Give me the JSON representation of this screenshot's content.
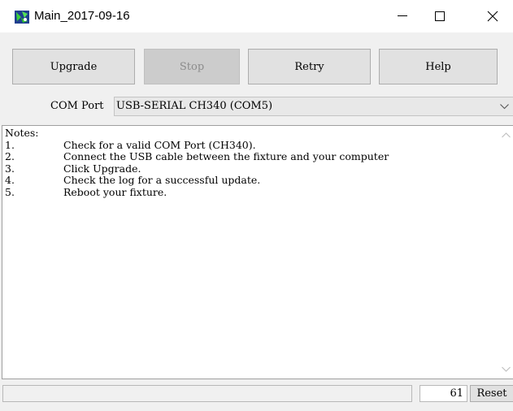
{
  "window": {
    "title": "Main_2017-09-16",
    "icon": "app-icon"
  },
  "toolbar": {
    "upgrade_label": "Upgrade",
    "stop_label": "Stop",
    "retry_label": "Retry",
    "help_label": "Help"
  },
  "com_port": {
    "label": "COM Port",
    "selected": "USB-SERIAL CH340 (COM5)"
  },
  "notes": {
    "header": "Notes:",
    "items": [
      {
        "num": "1.",
        "text": "Check for a valid COM Port (CH340)."
      },
      {
        "num": "2.",
        "text": "Connect the USB cable between the fixture and your computer"
      },
      {
        "num": "3.",
        "text": "Click Upgrade."
      },
      {
        "num": "4.",
        "text": "Check the log for a successful update."
      },
      {
        "num": "5.",
        "text": "Reboot your fixture."
      }
    ]
  },
  "status": {
    "counter": "61",
    "reset_label": "Reset"
  }
}
